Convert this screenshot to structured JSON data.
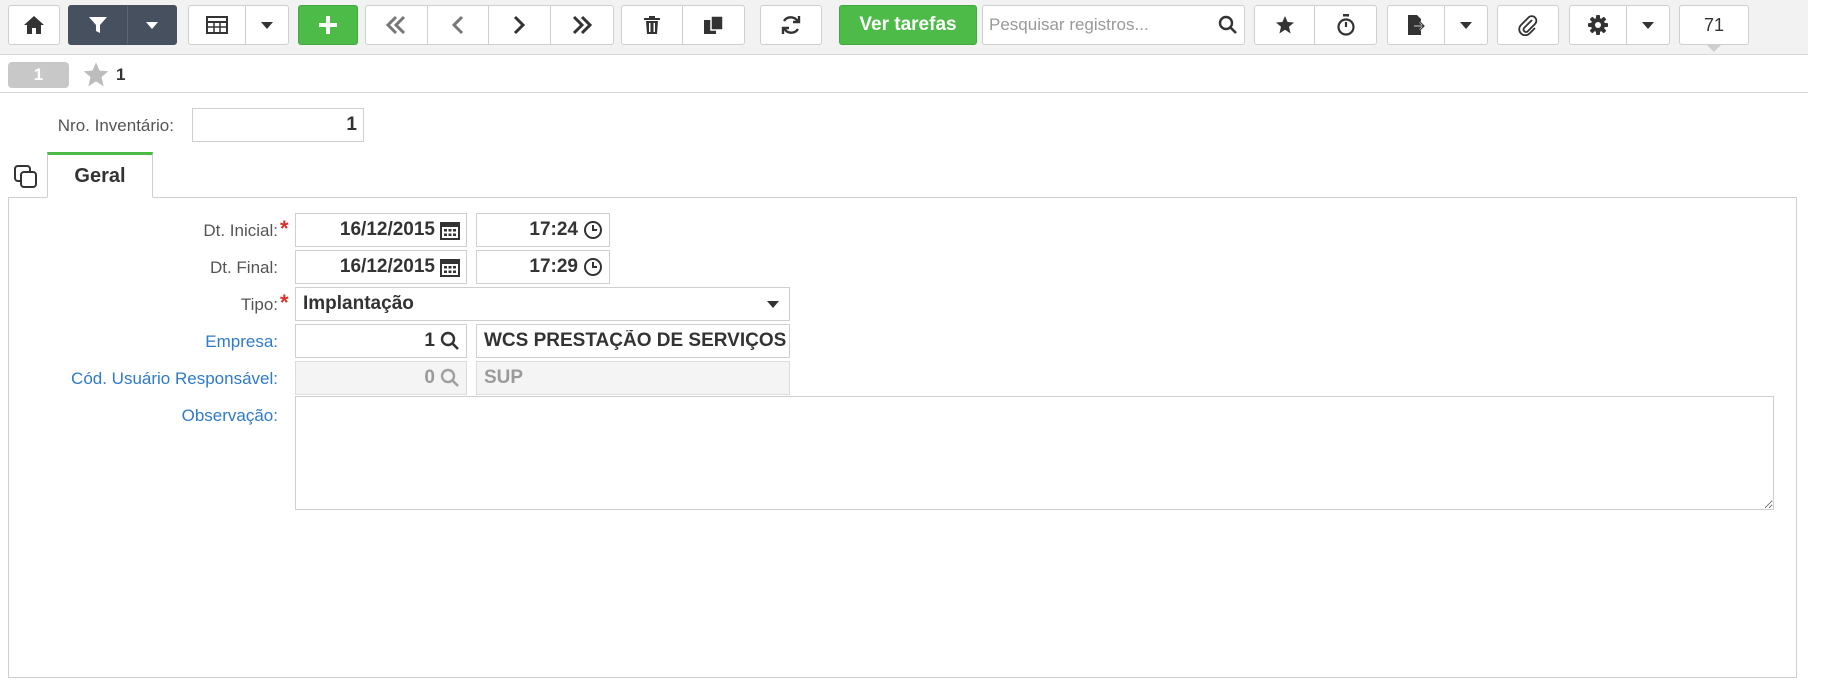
{
  "toolbar": {
    "tasks_label": "Ver tarefas",
    "search_placeholder": "Pesquisar registros...",
    "record_count": "71"
  },
  "record": {
    "badge": "1",
    "title": "1"
  },
  "form": {
    "inventory_number": {
      "label": "Nro. Inventário:",
      "value": "1"
    },
    "tab_label": "Geral",
    "start_date": {
      "label": "Dt. Inicial:",
      "date": "16/12/2015",
      "time": "17:24"
    },
    "end_date": {
      "label": "Dt. Final:",
      "date": "16/12/2015",
      "time": "17:29"
    },
    "type": {
      "label": "Tipo:",
      "value": "Implantação"
    },
    "company": {
      "label": "Empresa:",
      "code": "1",
      "name": "WCS PRESTAÇÃO DE SERVIÇOS"
    },
    "responsible_user": {
      "label": "Cód. Usuário Responsável:",
      "code": "0",
      "name": "SUP"
    },
    "observation": {
      "label": "Observação:",
      "value": ""
    }
  },
  "icons": {
    "home": "home-icon",
    "filter": "filter-icon",
    "grid": "grid-icon",
    "add": "plus-icon",
    "first": "double-chevron-left-icon",
    "prev": "chevron-left-icon",
    "next": "chevron-right-icon",
    "last": "double-chevron-right-icon",
    "delete": "trash-icon",
    "copy": "copy-icon",
    "refresh": "refresh-icon",
    "search": "search-icon",
    "favorite": "star-icon",
    "timer": "stopwatch-icon",
    "export": "export-icon",
    "attach": "paperclip-icon",
    "settings": "gear-icon"
  },
  "colors": {
    "primary_green": "#4cbb47",
    "dark_button": "#47505f",
    "link_blue": "#2f7ac9",
    "required_red": "#d9302c"
  }
}
